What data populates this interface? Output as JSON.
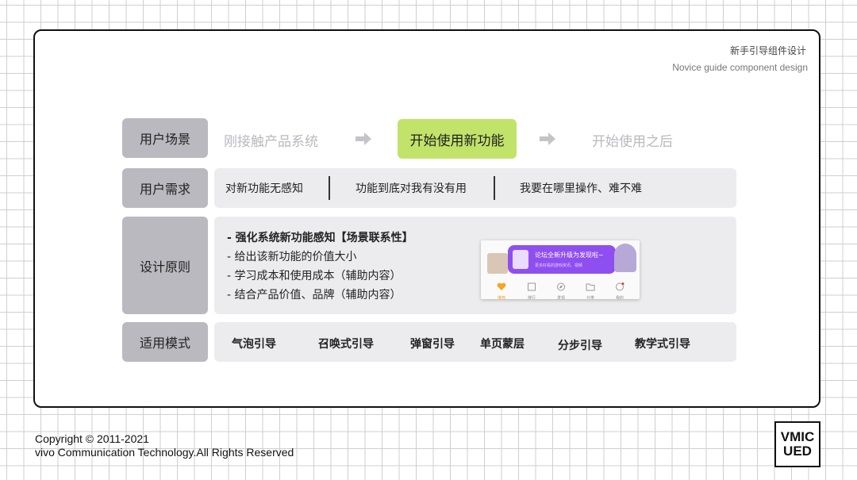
{
  "header": {
    "title": "新手引导组件设计",
    "subtitle": "Novice guide component design"
  },
  "scenario": {
    "label": "用户场景",
    "steps": [
      "刚接触产品系统",
      "开始使用新功能",
      "开始使用之后"
    ]
  },
  "needs": {
    "label": "用户需求",
    "items": [
      "对新功能无感知",
      "功能到底对我有没有用",
      "我要在哪里操作、难不难"
    ]
  },
  "principles": {
    "label": "设计原则",
    "items": [
      "-  强化系统新功能感知【场景联系性】",
      "-  给出该新功能的价值大小",
      "-  学习成本和使用成本（辅助内容）",
      "-  结合产品价值、品牌（辅助内容）"
    ],
    "example": {
      "bubble_title": "论坛全新升级为发现啦~",
      "bubble_sub": "更多好看的游戏资讯、视频",
      "tabs": [
        "推荐",
        "排行",
        "发现",
        "分类",
        "我的"
      ]
    }
  },
  "modes": {
    "label": "适用模式",
    "items": [
      "气泡引导",
      "召唤式引导",
      "弹窗引导",
      "单页蒙层",
      "分步引导",
      "教学式引导"
    ]
  },
  "footer": {
    "copyright": "Copyright © 2011-2021",
    "rights": "vivo Communication Technology.All Rights Reserved"
  },
  "logo": {
    "line1": "VMIC",
    "line2": "UED"
  },
  "colors": {
    "active": "#c2e36a",
    "label_bg": "#b9b9bf",
    "panel_bg": "#ececef",
    "bubble": "#8f4ef0",
    "tab_active": "#f5a623"
  }
}
